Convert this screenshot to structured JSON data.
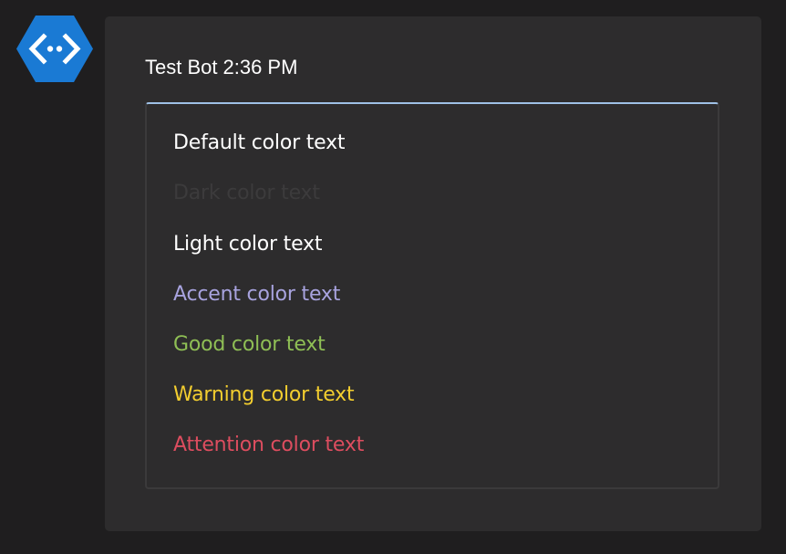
{
  "bot": {
    "avatar_icon": "bot-hexagon-icon",
    "avatar_color": "#1a7ad4",
    "name": "Test Bot",
    "time": "2:36 PM"
  },
  "card": {
    "accent_border_color": "#9fc1e6",
    "lines": [
      {
        "text": "Default color text",
        "color": "#ffffff"
      },
      {
        "text": "Dark color text",
        "color": "#3c3b3c"
      },
      {
        "text": "Light color text",
        "color": "#ffffff"
      },
      {
        "text": "Accent color text",
        "color": "#a8a3df"
      },
      {
        "text": "Good color text",
        "color": "#8fbf55"
      },
      {
        "text": "Warning color text",
        "color": "#f3ce2f"
      },
      {
        "text": "Attention color text",
        "color": "#dd4d5f"
      }
    ]
  }
}
